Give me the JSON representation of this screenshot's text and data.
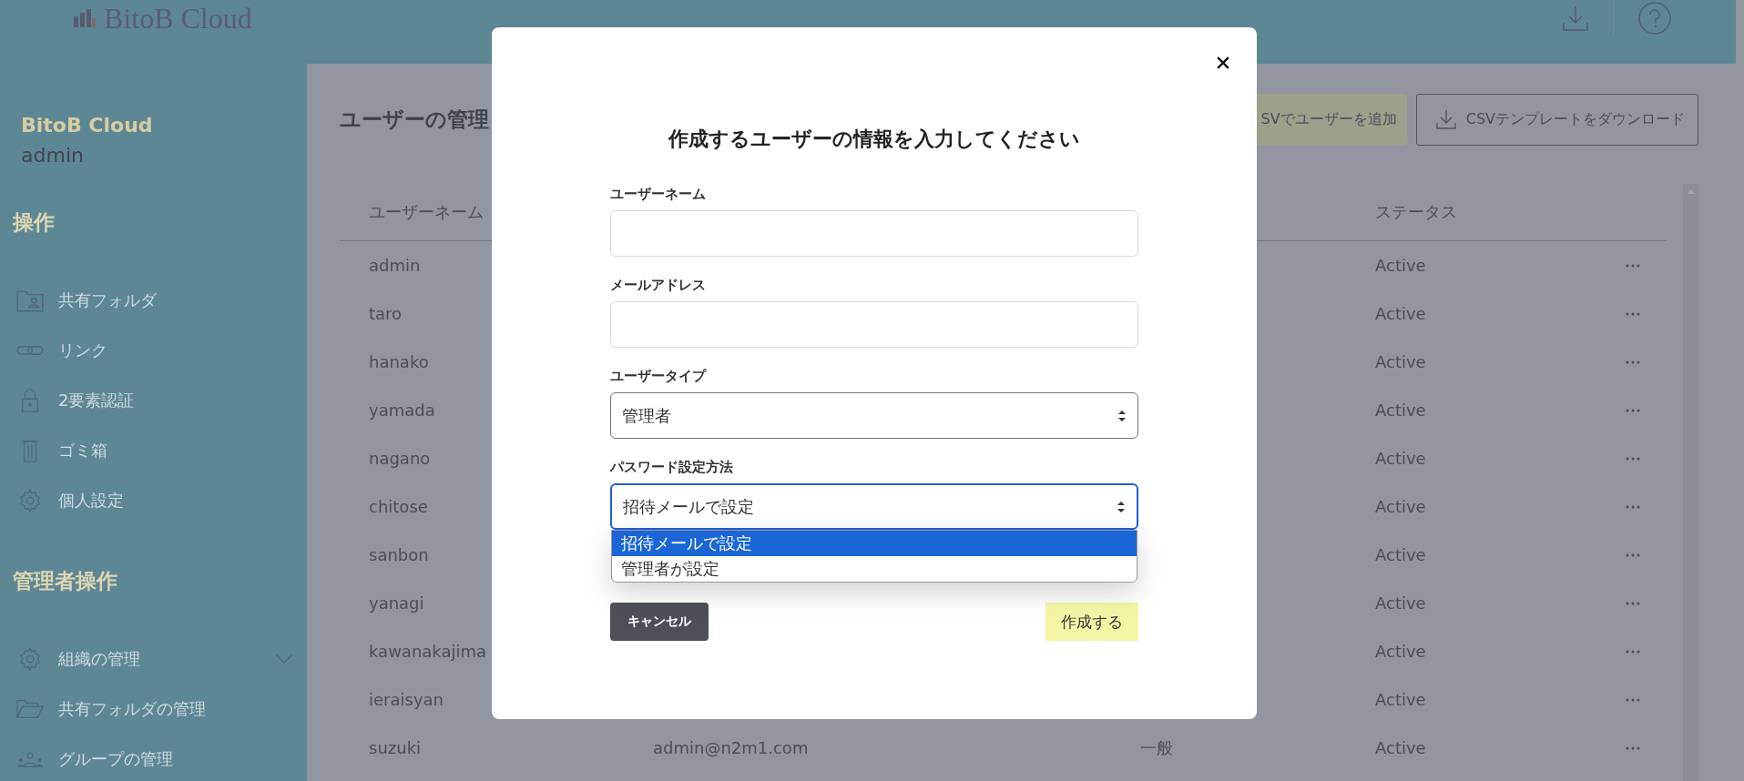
{
  "header": {
    "logo": "BitoB Cloud"
  },
  "sidebar": {
    "org": "BitoB Cloud",
    "user": "admin",
    "sections": [
      {
        "title": "操作",
        "items": [
          {
            "label": "共有フォルダ"
          },
          {
            "label": "リンク"
          },
          {
            "label": "2要素認証"
          },
          {
            "label": "ゴミ箱"
          },
          {
            "label": "個人設定"
          }
        ]
      },
      {
        "title": "管理者操作",
        "items": [
          {
            "label": "組織の管理",
            "expanded": false
          },
          {
            "label": "共有フォルダの管理"
          },
          {
            "label": "グループの管理"
          }
        ]
      }
    ]
  },
  "main": {
    "title": "ユーザーの管理",
    "buttons": [
      {
        "label": "SVでユーザーを追加",
        "kind": "import"
      },
      {
        "label": "CSVテンプレートをダウンロード",
        "kind": "download"
      }
    ],
    "table": {
      "columns": [
        "ユーザーネーム",
        "ステータス"
      ],
      "rows": [
        {
          "username": "admin",
          "status": "Active"
        },
        {
          "username": "taro",
          "status": "Active"
        },
        {
          "username": "hanako",
          "status": "Active"
        },
        {
          "username": "yamada",
          "status": "Active"
        },
        {
          "username": "nagano",
          "status": "Active"
        },
        {
          "username": "chitose",
          "status": "Active"
        },
        {
          "username": "sanbon",
          "status": "Active"
        },
        {
          "username": "yanagi",
          "status": "Active"
        },
        {
          "username": "kawanakajima",
          "status": "Active"
        },
        {
          "username": "ieraisyan",
          "status": "Active"
        },
        {
          "username": "suzuki",
          "email": "admin@n2m1.com",
          "user_type": "一般",
          "status": "Active"
        }
      ]
    }
  },
  "modal": {
    "title": "作成するユーザーの情報を入力してください",
    "fields": [
      {
        "label": "ユーザーネーム",
        "kind": "text"
      },
      {
        "label": "メールアドレス",
        "kind": "text"
      },
      {
        "label": "ユーザータイプ",
        "kind": "select",
        "value": "管理者",
        "focused": false
      },
      {
        "label": "パスワード設定方法",
        "kind": "select",
        "value": "招待メールで設定",
        "focused": true,
        "options": [
          {
            "label": "招待メールで設定",
            "selected": true
          },
          {
            "label": "管理者が設定",
            "selected": false
          }
        ]
      }
    ],
    "cancel": "キャンセル",
    "submit": "作成する"
  }
}
